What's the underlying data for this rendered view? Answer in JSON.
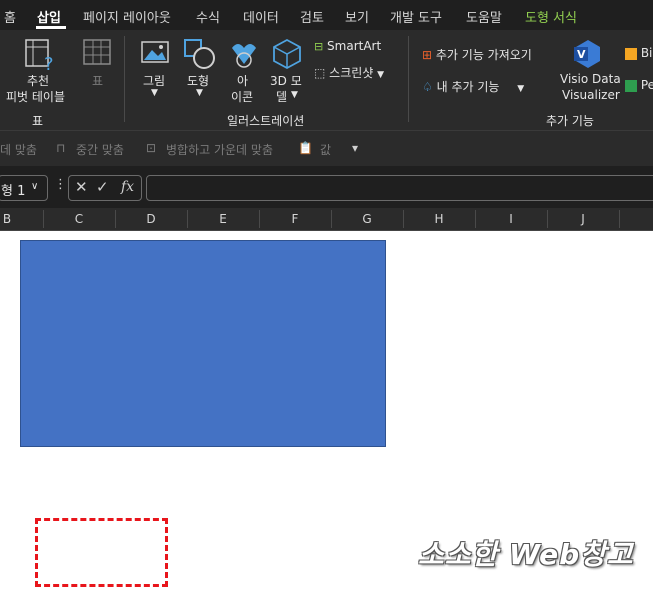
{
  "menu": {
    "tabs": [
      "홈",
      "삽입",
      "페이지 레이아웃",
      "수식",
      "데이터",
      "검토",
      "보기",
      "개발 도구",
      "도움말",
      "도형 서식"
    ],
    "active_tab": "삽입"
  },
  "ribbon": {
    "pivot_label": "추천\n피벗 테이블",
    "pivot_line1": "추천",
    "pivot_line2": "피벗 테이블",
    "table_label": "표",
    "picture_label": "그림",
    "shapes_label": "도형",
    "icons_line1": "아",
    "icons_line2": "이콘",
    "models_line1": "3D 모",
    "models_line2": "델",
    "smartart_label": "SmartArt",
    "screenshot_label": "스크린샷",
    "get_addins_label": "추가 기능 가져오기",
    "my_addins_label": "내 추가 기능",
    "visio_line1": "Visio Data",
    "visio_line2": "Visualizer",
    "bing_label": "Bi",
    "people_label": "Pe",
    "group_table": "표",
    "group_illustrations": "일러스트레이션",
    "group_addins": "추가 기능"
  },
  "toolbar2": {
    "align_center": "데 맞춤",
    "middle_align": "중간 맞춤",
    "merge_center": "병합하고 가운데 맞춤",
    "paste_values": "값"
  },
  "formula_bar": {
    "name_box": "형 1",
    "fx": "fx",
    "formula_value": ""
  },
  "columns": [
    "B",
    "C",
    "D",
    "E",
    "F",
    "G",
    "H",
    "I",
    "J"
  ],
  "watermark": "소소한 Web창고",
  "colors": {
    "shape_fill": "#4472c4",
    "highlight_border": "#e8151b",
    "ribbon_bg": "#2b2b2b",
    "shape_format_tab": "#92d050"
  }
}
